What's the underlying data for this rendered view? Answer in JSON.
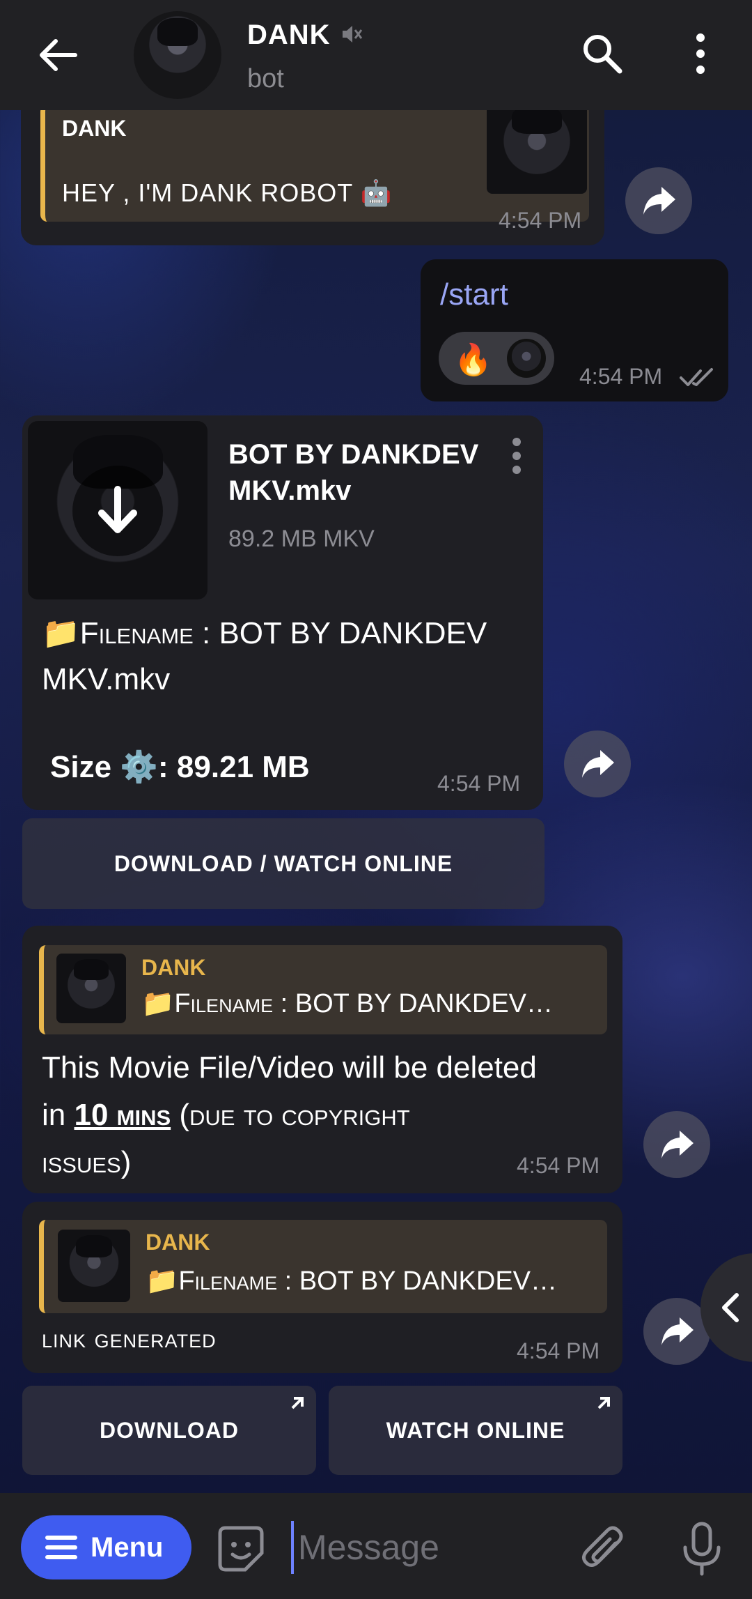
{
  "header": {
    "title": "DANK",
    "subtitle": "bot"
  },
  "messages": {
    "greeting": {
      "quote_name": "DANK",
      "quote_text": "HEY , I'M DANK ROBOT 🤖",
      "time": "4:54 PM"
    },
    "outgoing": {
      "text": "/start",
      "reaction_emoji": "🔥",
      "time": "4:54 PM",
      "status": "read"
    },
    "file": {
      "file_title": "BOT BY DANKDEV MKV.mkv",
      "file_meta": "89.2 MB MKV",
      "caption_prefix": "📁",
      "caption_label": "Filename",
      "caption_value": " : BOT BY DANKDEV MKV.mkv",
      "size_label": "Size ⚙️: 89.21 MB",
      "time": "4:54 PM",
      "button": "DOWNLOAD / WATCH ONLINE"
    },
    "warning": {
      "quote_name": "DANK",
      "quote_prefix": "📁",
      "quote_label": "Filename",
      "quote_value": " : BOT BY DANKDEV…",
      "line1": "This Movie File/Video will be deleted",
      "line2_prefix": "in ",
      "line2_link": "10 mins",
      "line2_rest": " (due to copyright",
      "line3": "issues)",
      "time": "4:54 PM"
    },
    "link": {
      "quote_name": "DANK",
      "quote_prefix": "📁",
      "quote_label": "Filename",
      "quote_value": " : BOT BY DANKDEV…",
      "text": "link generated",
      "time": "4:54 PM",
      "button_download": "DOWNLOAD",
      "button_watch": "WATCH ONLINE"
    }
  },
  "composer": {
    "menu_label": "Menu",
    "placeholder": "Message"
  },
  "colors": {
    "accent": "#3f5cf0",
    "quote_name": "#e8b64c",
    "bubble": "#1f1f24",
    "header": "#212124"
  }
}
